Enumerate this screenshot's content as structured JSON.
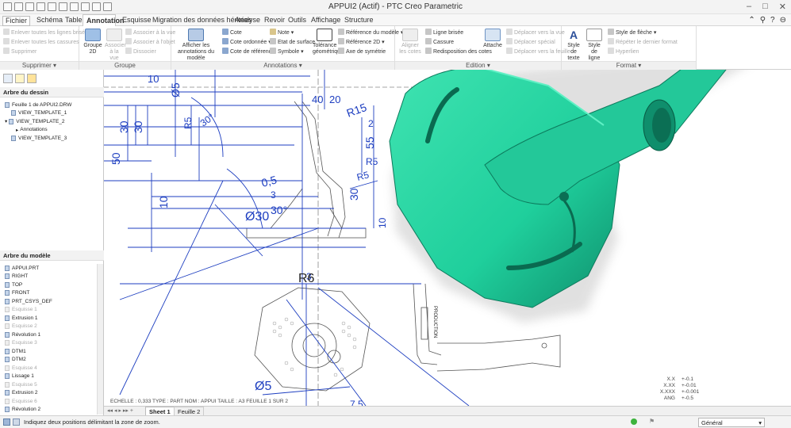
{
  "window": {
    "title": "APPUI2 (Actif) - PTC Creo Parametric"
  },
  "menu_tabs": [
    "Fichier ▾",
    "Schéma",
    "Table",
    "Annotation",
    "Esquisse",
    "Migration des données héritées",
    "Analyse",
    "Revoir",
    "Outils",
    "Affichage",
    "Structure"
  ],
  "ribbon": {
    "supprimer": {
      "items": [
        "Enlever toutes les lignes brisées",
        "Enlever toutes les cassures",
        "Supprimer"
      ],
      "label": "Supprimer ▾"
    },
    "groupe": {
      "big": "Groupe 2D",
      "assoc": "Associer à la vue",
      "items": [
        "Associer à la vue",
        "Associer à l'objet",
        "Dissocier"
      ],
      "label": "Groupe"
    },
    "annotations": {
      "big": "Afficher les annotations du modèle",
      "col1": [
        "Cote",
        "Cote ordonnée ▾",
        "Cote de référence"
      ],
      "col2": [
        "Note ▾",
        "Etat de surface",
        "Symbole ▾"
      ],
      "tol": "Tolérance géométrique",
      "col3": [
        "Référence du modèle ▾",
        "Référence 2D ▾",
        "Axe de symétrie"
      ],
      "label": "Annotations ▾"
    },
    "edition": {
      "align": "Aligner les cotes",
      "col1": [
        "Ligne brisée",
        "Cassure",
        "Redisposition des cotes"
      ],
      "attache": "Attache",
      "col2": [
        "Déplacer vers la vue",
        "Déplacer spécial",
        "Déplacer vers la feuille"
      ],
      "label": "Edition ▾"
    },
    "format": {
      "style_texte": "Style de texte",
      "style_ligne": "Style de ligne",
      "col": [
        "Style de flèche ▾",
        "Répéter le dernier format",
        "Hyperlien"
      ],
      "label": "Format ▾"
    }
  },
  "drawing_tree": {
    "title": "Arbre du dessin",
    "items": [
      "Feuille 1 de APPUI2.DRW",
      "VIEW_TEMPLATE_1",
      "VIEW_TEMPLATE_2",
      "Annotations",
      "VIEW_TEMPLATE_3"
    ]
  },
  "model_tree": {
    "title": "Arbre du modèle",
    "items": [
      {
        "label": "APPUI.PRT",
        "dim": false
      },
      {
        "label": "RIGHT",
        "dim": false
      },
      {
        "label": "TOP",
        "dim": false
      },
      {
        "label": "FRONT",
        "dim": false
      },
      {
        "label": "PRT_CSYS_DEF",
        "dim": false
      },
      {
        "label": "Esquisse 1",
        "dim": true
      },
      {
        "label": "Extrusion 1",
        "dim": false
      },
      {
        "label": "Esquisse 2",
        "dim": true
      },
      {
        "label": "Révolution 1",
        "dim": false
      },
      {
        "label": "Esquisse 3",
        "dim": true
      },
      {
        "label": "DTM1",
        "dim": false
      },
      {
        "label": "DTM2",
        "dim": false
      },
      {
        "label": "Esquisse 4",
        "dim": true
      },
      {
        "label": "Lissage 1",
        "dim": false
      },
      {
        "label": "Esquisse 5",
        "dim": true
      },
      {
        "label": "Extrusion 2",
        "dim": false
      },
      {
        "label": "Esquisse 6",
        "dim": true
      },
      {
        "label": "Révolution 2",
        "dim": false
      }
    ]
  },
  "drawing": {
    "dims": [
      "10",
      "Ø5",
      "40",
      "20",
      "30",
      "30",
      "R5",
      "30°",
      "R15",
      "2",
      "55",
      "50",
      "0,5",
      "R5",
      "30",
      "3",
      "10",
      "Ø30",
      "30°",
      "R6",
      "3",
      "Ø5",
      "7,5",
      "10",
      "R5"
    ],
    "footer": "ECHELLE : 0,333    TYPE : PART    NOM : APPUI    TAILLE : A3    FEUILLE 1 SUR 2",
    "side_label": "PRODUCTION",
    "tolerances": [
      {
        "key": "X.X",
        "val": "+-0.1"
      },
      {
        "key": "X.XX",
        "val": "+-0.01"
      },
      {
        "key": "X.XXX",
        "val": "+-0.001"
      },
      {
        "key": "ANG",
        "val": "+-0.5"
      }
    ]
  },
  "sheets": [
    "Sheet 1",
    "Feuille 2"
  ],
  "status": {
    "message": "Indiquez deux positions délimitant la zone de zoom.",
    "filter": "Général"
  },
  "colors": {
    "dim": "#1d3ec0",
    "part": "#1fcf9c",
    "part_dark": "#11896a",
    "geom": "#555555"
  }
}
